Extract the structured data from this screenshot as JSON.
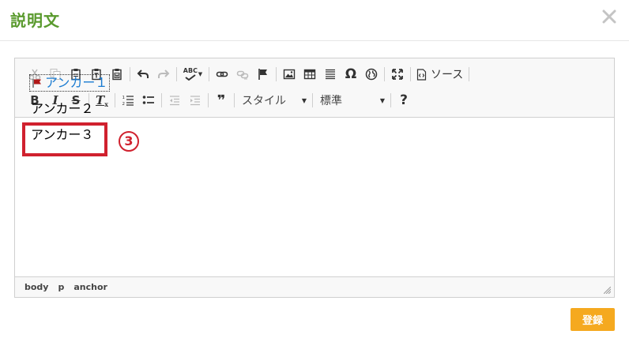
{
  "dialog": {
    "title": "説明文",
    "close_glyph": "✕",
    "submit_label": "登録"
  },
  "toolbar": {
    "row1": [
      "cut-icon",
      "copy-icon",
      "paste-icon",
      "paste-text-icon",
      "paste-word-icon",
      "undo-icon",
      "redo-icon",
      "spellcheck-icon",
      "link-icon",
      "unlink-icon",
      "anchor-flag-icon",
      "image-icon",
      "table-icon",
      "horizontal-rule-icon",
      "special-char-icon",
      "iframe-globe-icon",
      "maximize-icon",
      "source-icon"
    ],
    "source_label": "ソース",
    "spell_label": "ABC",
    "bold_label": "B",
    "italic_label": "I",
    "strike_label": "S",
    "remove_format_label": "T",
    "omega": "Ω",
    "quote": "❞",
    "help": "?",
    "style_combo": "スタイル",
    "format_combo": "標準"
  },
  "content": {
    "paragraphs": [
      "アンカー１",
      "アンカー２",
      "アンカー３"
    ]
  },
  "annotation": {
    "step": "3",
    "highlight_color": "#d0212e"
  },
  "statusbar": {
    "path": [
      "body",
      "p",
      "anchor"
    ]
  },
  "colors": {
    "title": "#5a9a2e",
    "submit": "#f5a91f",
    "link": "#1a7bd1"
  }
}
